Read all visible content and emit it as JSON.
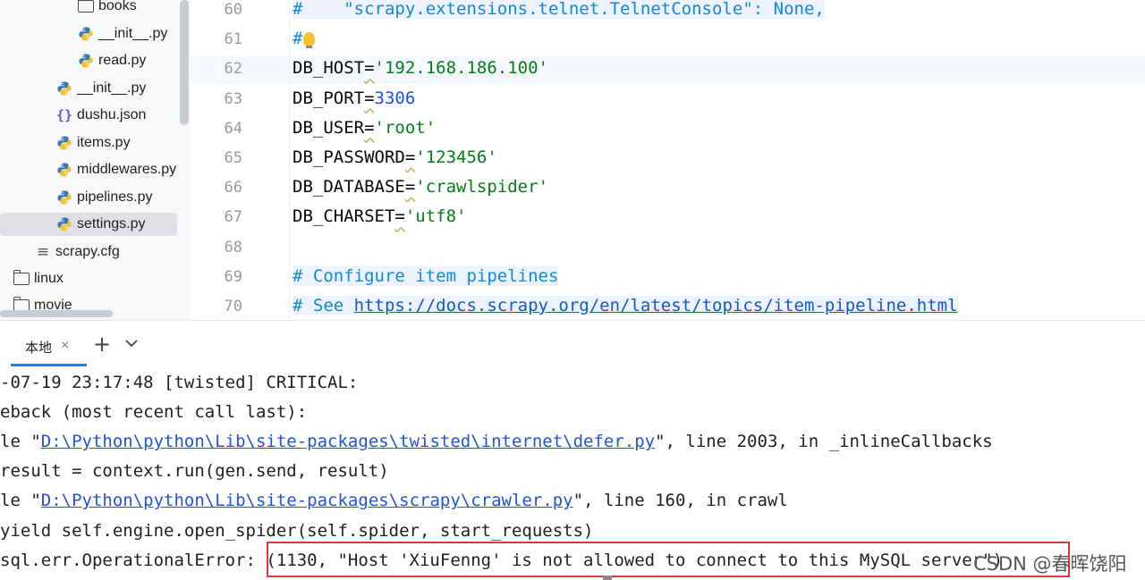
{
  "project_tree": {
    "items": [
      {
        "label": "books",
        "icon": "folder-icon"
      },
      {
        "label": "__init__.py",
        "icon": "python-file-icon"
      },
      {
        "label": "read.py",
        "icon": "python-file-icon"
      },
      {
        "label": "__init__.py",
        "icon": "python-file-icon"
      },
      {
        "label": "dushu.json",
        "icon": "json-file-icon"
      },
      {
        "label": "items.py",
        "icon": "python-file-icon"
      },
      {
        "label": "middlewares.py",
        "icon": "python-file-icon"
      },
      {
        "label": "pipelines.py",
        "icon": "python-file-icon"
      },
      {
        "label": "settings.py",
        "icon": "python-file-icon",
        "selected": true
      },
      {
        "label": "scrapy.cfg",
        "icon": "config-file-icon"
      },
      {
        "label": "linux",
        "icon": "folder-icon"
      },
      {
        "label": "movie",
        "icon": "folder-icon"
      }
    ]
  },
  "editor": {
    "current_line": "62",
    "lines": [
      {
        "number": "60",
        "parts": [
          {
            "t": "#    \"scrapy.extensions.telnet.TelnetConsole\": None,",
            "c": "cmt hl"
          }
        ]
      },
      {
        "number": "61",
        "parts": [
          {
            "t": "#",
            "c": "cmt"
          }
        ]
      },
      {
        "number": "62",
        "parts": [
          {
            "t": "DB_HOST",
            "c": ""
          },
          {
            "t": "=",
            "c": "eq"
          },
          {
            "t": "'192.168.186.100'",
            "c": "str"
          }
        ]
      },
      {
        "number": "63",
        "parts": [
          {
            "t": "DB_PORT",
            "c": ""
          },
          {
            "t": "=",
            "c": "eq"
          },
          {
            "t": "3306",
            "c": "num"
          }
        ]
      },
      {
        "number": "64",
        "parts": [
          {
            "t": "DB_USER",
            "c": ""
          },
          {
            "t": "=",
            "c": "eq"
          },
          {
            "t": "'root'",
            "c": "str"
          }
        ]
      },
      {
        "number": "65",
        "parts": [
          {
            "t": "DB_PASSWORD",
            "c": ""
          },
          {
            "t": "=",
            "c": "eq"
          },
          {
            "t": "'123456'",
            "c": "str"
          }
        ]
      },
      {
        "number": "66",
        "parts": [
          {
            "t": "DB_DATABASE",
            "c": ""
          },
          {
            "t": "=",
            "c": "eq"
          },
          {
            "t": "'crawlspider'",
            "c": "str"
          }
        ]
      },
      {
        "number": "67",
        "parts": [
          {
            "t": "DB_CHARSET",
            "c": ""
          },
          {
            "t": "=",
            "c": "eq"
          },
          {
            "t": "'utf8'",
            "c": "str"
          }
        ]
      },
      {
        "number": "68",
        "parts": []
      },
      {
        "number": "69",
        "parts": [
          {
            "t": "# Configure item pipelines",
            "c": "cmt hl"
          }
        ]
      },
      {
        "number": "70",
        "parts": [
          {
            "t": "# See ",
            "c": "cmt hl"
          },
          {
            "t": "https://docs.scrapy.org/en/latest/topics/item-pipeline.html",
            "c": "link hl"
          }
        ]
      }
    ]
  },
  "terminal": {
    "tab_label": "本地",
    "close_symbol": "×",
    "new_tab_symbol": "+",
    "lines": [
      [
        {
          "t": "-07-19 23:17:48 [twisted] CRITICAL:",
          "c": ""
        }
      ],
      [
        {
          "t": "eback (most recent call last):",
          "c": ""
        }
      ],
      [
        {
          "t": "le \"",
          "c": ""
        },
        {
          "t": "D:\\Python\\python\\Lib\\site-packages\\twisted\\internet\\defer.py",
          "c": "tlink"
        },
        {
          "t": "\", line 2003, in _inlineCallbacks",
          "c": ""
        }
      ],
      [
        {
          "t": "result = context.run(gen.send, result)",
          "c": ""
        }
      ],
      [
        {
          "t": "le \"",
          "c": ""
        },
        {
          "t": "D:\\Python\\python\\Lib\\site-packages\\scrapy\\crawler.py",
          "c": "tlink"
        },
        {
          "t": "\", line 160, in crawl",
          "c": ""
        }
      ],
      [
        {
          "t": "yield self.engine.open_spider(self.spider, start_requests)",
          "c": ""
        }
      ],
      [
        {
          "t": "sql.err.OperationalError: (1130, \"Host 'XiuFenng' is not allowed to connect to this MySQL server\")",
          "c": ""
        }
      ]
    ],
    "watermark": "CSDN @春晖饶阳"
  },
  "colors": {
    "error_box": "#e0353a",
    "tab_accent": "#3574f0",
    "comment": "#0f8ad9",
    "string": "#067d17",
    "number": "#1750eb"
  }
}
